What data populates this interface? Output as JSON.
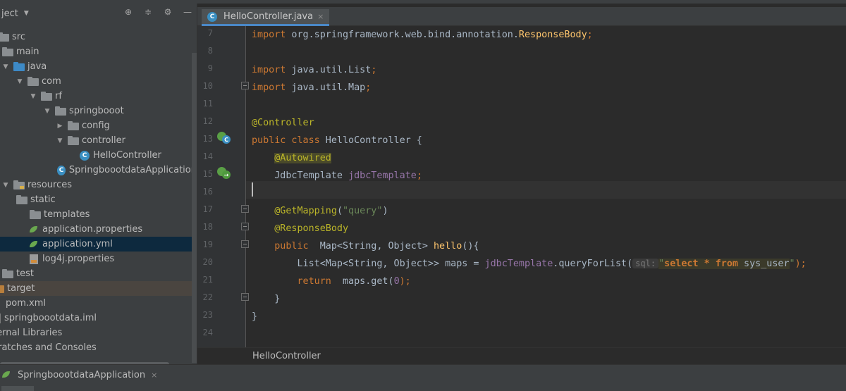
{
  "project_panel": {
    "title": "ject",
    "tree": [
      {
        "indent": 0,
        "arrow": "",
        "icon": "folder",
        "label": "src"
      },
      {
        "indent": 1,
        "arrow": "",
        "icon": "folder",
        "label": "main"
      },
      {
        "indent": 1,
        "arrow": "▼",
        "icon": "folder-blue",
        "label": "java"
      },
      {
        "indent": 2,
        "arrow": "▼",
        "icon": "folder",
        "label": "com"
      },
      {
        "indent": 3,
        "arrow": "▼",
        "icon": "folder",
        "label": "rf"
      },
      {
        "indent": 4,
        "arrow": "▼",
        "icon": "folder",
        "label": "springbooot"
      },
      {
        "indent": 5,
        "arrow": "▶",
        "icon": "folder",
        "label": "config"
      },
      {
        "indent": 5,
        "arrow": "▼",
        "icon": "folder",
        "label": "controller"
      },
      {
        "indent": 6,
        "arrow": "",
        "icon": "class",
        "label": "HelloController"
      },
      {
        "indent": 5,
        "arrow": "",
        "icon": "class-app",
        "label": "SpringboootdataApplication"
      },
      {
        "indent": 1,
        "arrow": "▼",
        "icon": "folder-res",
        "label": "resources"
      },
      {
        "indent": 2,
        "arrow": "",
        "icon": "folder",
        "label": "static"
      },
      {
        "indent": 2,
        "arrow": "",
        "icon": "folder",
        "label": "templates"
      },
      {
        "indent": 2,
        "arrow": "",
        "icon": "spring-leaf",
        "label": "application.properties"
      },
      {
        "indent": 2,
        "arrow": "",
        "icon": "spring-leaf",
        "label": "application.yml",
        "selected": true
      },
      {
        "indent": 2,
        "arrow": "",
        "icon": "properties-file",
        "label": "log4j.properties"
      },
      {
        "indent": 0,
        "arrow": "",
        "icon": "folder",
        "label": "test"
      },
      {
        "indent": 0,
        "arrow": "",
        "icon": "folder-orange",
        "label": "target",
        "highlighted": true
      },
      {
        "indent": 0,
        "arrow": "",
        "icon": "xml-file",
        "label": "pom.xml"
      },
      {
        "indent": 0,
        "arrow": "",
        "icon": "iml-file",
        "label": "springboootdata.iml"
      },
      {
        "indent": 0,
        "arrow": "",
        "icon": "",
        "label": "ternal Libraries"
      },
      {
        "indent": 0,
        "arrow": "",
        "icon": "",
        "label": "cratches and Consoles"
      }
    ]
  },
  "editor": {
    "tab_label": "HelloController.java",
    "tab_close": "×",
    "line_numbers": [
      "7",
      "8",
      "9",
      "10",
      "11",
      "12",
      "13",
      "14",
      "15",
      "16",
      "17",
      "18",
      "19",
      "20",
      "21",
      "22",
      "23",
      "24"
    ],
    "code": {
      "l7": {
        "kw": "import",
        "rest": " org.springframework.web.bind.annotation.",
        "cls": "ResponseBody",
        "end": ";"
      },
      "l9": {
        "kw": "import",
        "rest": " java.util.List",
        "end": ";"
      },
      "l10": {
        "kw": "import",
        "rest": " java.util.Map",
        "end": ";"
      },
      "l12": {
        "ann": "@Controller"
      },
      "l13": {
        "kw": "public class",
        "rest": " HelloController {"
      },
      "l14": {
        "ann": "@Autowired"
      },
      "l15": {
        "type": "JdbcTemplate ",
        "field": "jdbcTemplate",
        "end": ";"
      },
      "l17": {
        "ann": "@GetMapping",
        "open": "(",
        "str": "\"query\"",
        "close": ")"
      },
      "l18": {
        "ann": "@ResponseBody"
      },
      "l19": {
        "kw": "public",
        "rest": "  Map<String, Object> ",
        "fn": "hello",
        "end": "(){"
      },
      "l20": {
        "pre": "List<Map<String, Object>> maps = ",
        "field": "jdbcTemplate",
        "call": ".queryForList(",
        "hint": "sql:",
        "q1": "\"",
        "sql1": "select",
        "star": " * ",
        "sql2": "from",
        "tbl": " sys_user",
        "q2": "\"",
        "end": ");"
      },
      "l21": {
        "kw": "return",
        "rest": "  maps.get(",
        "num": "0",
        "end": ");"
      },
      "l22": {
        "rest": "}"
      },
      "l23": {
        "rest": "}"
      }
    },
    "breadcrumb": "HelloController"
  },
  "run_panel": {
    "tab_label": "SpringboootdataApplication",
    "tab_close": "×"
  }
}
